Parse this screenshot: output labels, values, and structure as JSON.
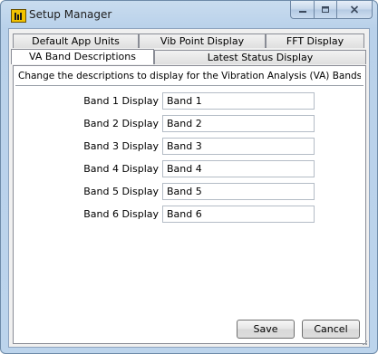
{
  "window": {
    "title": "Setup Manager",
    "app_icon": "app-logo-icon",
    "controls": {
      "minimize": "minimize-icon",
      "maximize": "maximize-icon",
      "close": "close-icon"
    }
  },
  "tabs": {
    "row_top": [
      {
        "label": "Default App Units"
      },
      {
        "label": "Vib Point Display"
      },
      {
        "label": "FFT Display"
      }
    ],
    "row_bottom": [
      {
        "label": "VA Band Descriptions",
        "active": true
      },
      {
        "label": "Latest Status Display"
      }
    ]
  },
  "va_bands": {
    "instructions": "Change the descriptions to display for the Vibration Analysis (VA) Bands below:",
    "bands": [
      {
        "label": "Band 1 Display",
        "value": "Band 1"
      },
      {
        "label": "Band 2 Display",
        "value": "Band 2"
      },
      {
        "label": "Band 3 Display",
        "value": "Band 3"
      },
      {
        "label": "Band 4 Display",
        "value": "Band 4"
      },
      {
        "label": "Band 5 Display",
        "value": "Band 5"
      },
      {
        "label": "Band 6 Display",
        "value": "Band 6"
      }
    ]
  },
  "buttons": {
    "save": "Save",
    "cancel": "Cancel"
  },
  "colors": {
    "title_bar": "#b9d1ea",
    "dialog_background": "#f0f0f0",
    "tab_page_background": "#ffffff"
  }
}
